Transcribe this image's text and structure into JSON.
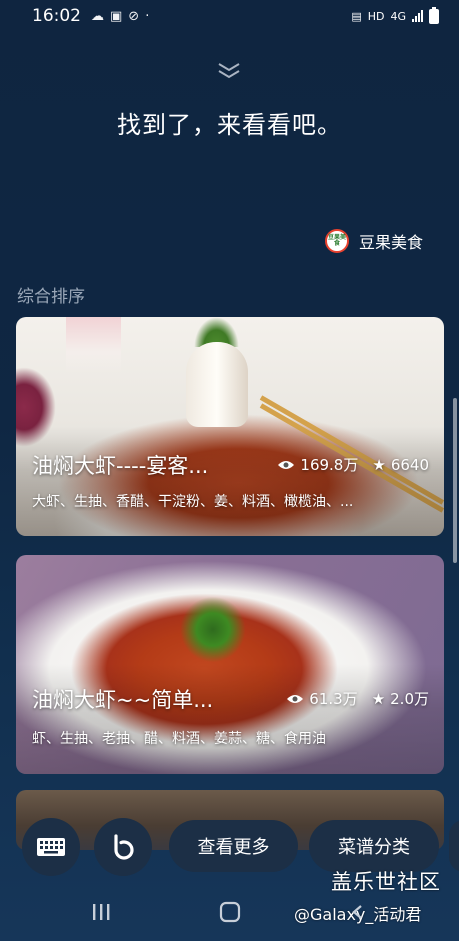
{
  "status_bar": {
    "time": "16:02",
    "hd_label": "HD",
    "network_label": "4G",
    "icons": [
      "cloud-icon",
      "pay-icon",
      "blocked-icon",
      "dot-icon",
      "nfc-icon",
      "signal-icon",
      "battery-icon"
    ]
  },
  "header": {
    "title": "找到了，来看看吧。",
    "source_name": "豆果美食",
    "source_logo_text": "豆果美食"
  },
  "sort_label": "综合排序",
  "cards": [
    {
      "title": "油焖大虾----宴客...",
      "views": "169.8万",
      "favorites": "6640",
      "ingredients": "大虾、生抽、香醋、干淀粉、姜、料酒、橄榄油、..."
    },
    {
      "title": "油焖大虾~~简单...",
      "views": "61.3万",
      "favorites": "2.0万",
      "ingredients": "虾、生抽、老抽、醋、料酒、姜蒜、糖、食用油"
    }
  ],
  "actions": {
    "more_label": "查看更多",
    "category_label": "菜谱分类"
  },
  "watermark": {
    "line1": "盖乐世社区",
    "line2": "@Galaxy_活动君"
  },
  "colors": {
    "background": "#0f2540",
    "button": "#1c2f46",
    "sort_label": "#9aa7b8"
  }
}
